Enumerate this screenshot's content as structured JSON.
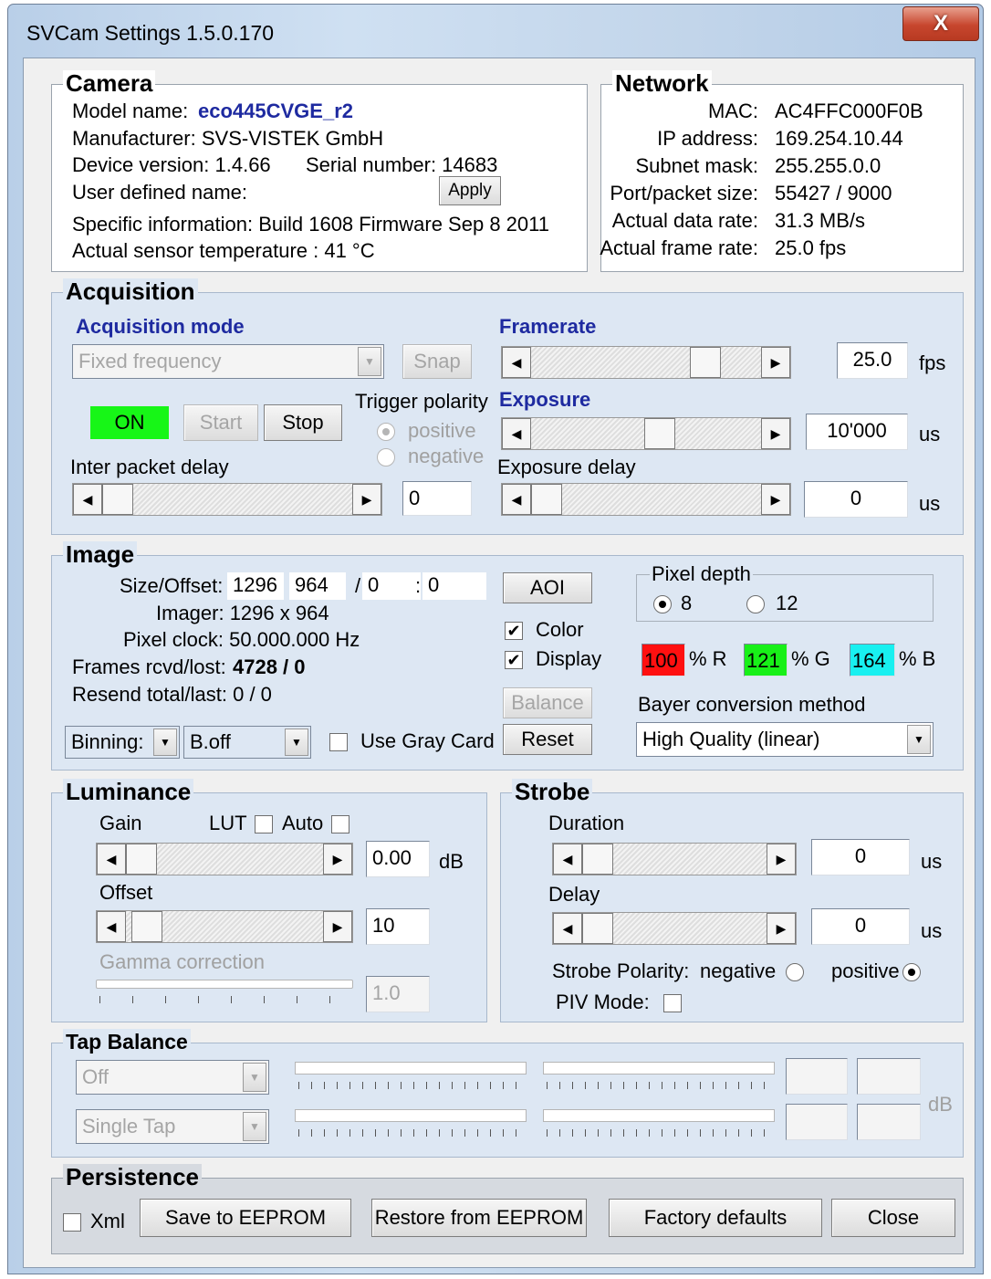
{
  "window": {
    "title": "SVCam Settings 1.5.0.170",
    "close_label": "X"
  },
  "camera": {
    "title": "Camera",
    "model_label": "Model name:",
    "model_value": "eco445CVGE_r2",
    "manufacturer": "Manufacturer: SVS-VISTEK GmbH",
    "device_version": "Device version: 1.4.66",
    "serial_number": "Serial number: 14683",
    "user_defined_label": "User defined name:",
    "apply_label": "Apply",
    "specific_info": "Specific information:  Build 1608 Firmware Sep  8 2011",
    "temperature": "Actual sensor temperature :  41 °C"
  },
  "network": {
    "title": "Network",
    "rows": [
      {
        "label": "MAC:",
        "value": "AC4FFC000F0B"
      },
      {
        "label": "IP address:",
        "value": "169.254.10.44"
      },
      {
        "label": "Subnet mask:",
        "value": "255.255.0.0"
      },
      {
        "label": "Port/packet size:",
        "value": "55427  /  9000"
      },
      {
        "label": "Actual data rate:",
        "value": "31.3 MB/s"
      },
      {
        "label": "Actual frame rate:",
        "value": "25.0 fps"
      }
    ]
  },
  "acquisition": {
    "title": "Acquisition",
    "mode_label": "Acquisition mode",
    "mode_value": "Fixed frequency",
    "snap_label": "Snap",
    "on_label": "ON",
    "on_color": "#17f617",
    "start_label": "Start",
    "stop_label": "Stop",
    "trigger_polarity_label": "Trigger polarity",
    "positive_label": "positive",
    "negative_label": "negative",
    "inter_packet_label": "Inter packet delay",
    "inter_packet_value": "0",
    "framerate_label": "Framerate",
    "framerate_value": "25.0",
    "framerate_unit": "fps",
    "exposure_label": "Exposure",
    "exposure_value": "10'000",
    "exposure_unit": "us",
    "exposure_delay_label": "Exposure delay",
    "exposure_delay_value": "0",
    "exposure_delay_unit": "us"
  },
  "image": {
    "title": "Image",
    "size_label": "Size/Offset:",
    "width": "1296",
    "height": "964",
    "off_x_prefix": "/",
    "off_x": "0",
    "off_y_prefix": ":",
    "off_y": "0",
    "imager": "Imager:  1296 x  964",
    "pixel_clock": "Pixel clock:  50.000.000 Hz",
    "frames_label": "Frames rcvd/lost:",
    "frames_value": "4728 / 0",
    "resend": "Resend total/last:  0 / 0",
    "binning_value": "Binning:",
    "boff_value": "B.off",
    "gray_card_label": "Use Gray Card",
    "aoi_label": "AOI",
    "color_label": "Color",
    "display_label": "Display",
    "balance_label": "Balance",
    "reset_label": "Reset",
    "pixel_depth_label": "Pixel depth",
    "depth_8": "8",
    "depth_12": "12",
    "r_value": "100",
    "r_unit": "% R",
    "r_color": "#ff1010",
    "g_value": "121",
    "g_unit": "% G",
    "g_color": "#18f018",
    "b_value": "164",
    "b_unit": "% B",
    "b_color": "#18f0f0",
    "bayer_label": "Bayer conversion method",
    "bayer_value": "High Quality (linear)"
  },
  "luminance": {
    "title": "Luminance",
    "gain_label": "Gain",
    "lut_label": "LUT",
    "auto_label": "Auto",
    "gain_value": "0.00",
    "gain_unit": "dB",
    "offset_label": "Offset",
    "offset_value": "10",
    "gamma_label": "Gamma correction",
    "gamma_value": "1.0"
  },
  "strobe": {
    "title": "Strobe",
    "duration_label": "Duration",
    "duration_value": "0",
    "duration_unit": "us",
    "delay_label": "Delay",
    "delay_value": "0",
    "delay_unit": "us",
    "polarity_label": "Strobe Polarity:",
    "negative_label": "negative",
    "positive_label": "positive",
    "piv_label": "PIV Mode:"
  },
  "tap_balance": {
    "title": "Tap Balance",
    "mode_value": "Off",
    "tap_value": "Single Tap",
    "unit": "dB"
  },
  "persistence": {
    "title": "Persistence",
    "xml_label": "Xml",
    "save_label": "Save to EEPROM",
    "restore_label": "Restore from EEPROM",
    "factory_label": "Factory defaults",
    "close_label": "Close"
  }
}
